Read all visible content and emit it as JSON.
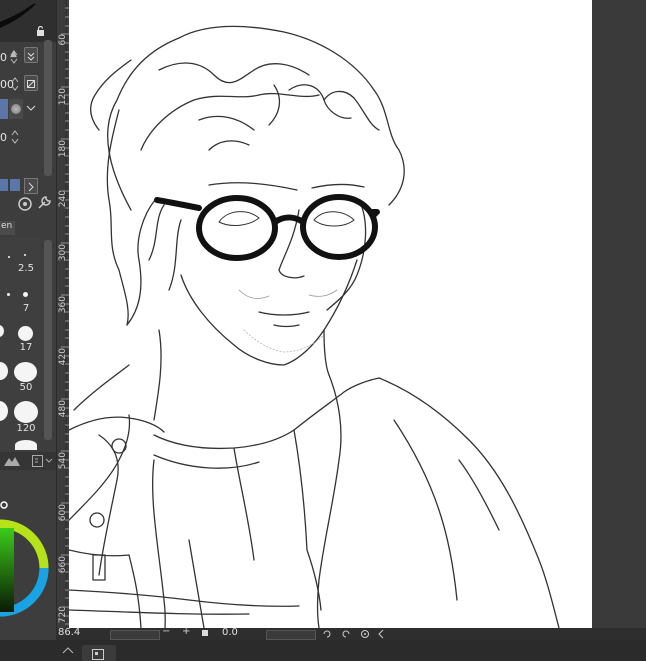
{
  "tool_property": {
    "brush_size_value": "0",
    "opacity_value": "00",
    "stabilization_value": "0",
    "blend_tab_label": "en"
  },
  "brush_sizes": [
    "2.5",
    "7",
    "17",
    "50",
    "120"
  ],
  "ruler": {
    "labels": [
      "60",
      "120",
      "180",
      "240",
      "300",
      "360",
      "420",
      "480",
      "540",
      "600",
      "660",
      "720"
    ]
  },
  "status_bar": {
    "zoom": "86.4",
    "rotation": "0.0"
  },
  "colors": {
    "panel_bg": "#3d3d3d",
    "canvas_bg": "#3a3a3a",
    "paper": "#ffffff",
    "lineart": "#2a2a2a",
    "accent_blue": "#5b76a8"
  }
}
